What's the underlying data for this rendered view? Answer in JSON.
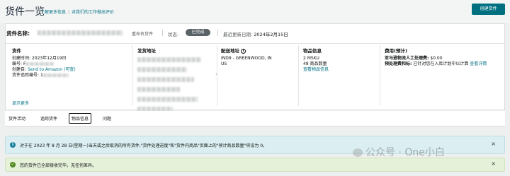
{
  "header": {
    "title": "货件一览",
    "links": [
      "了解更多信息",
      "对我们的工作做出评价"
    ],
    "create_button": "创建货件"
  },
  "shipment": {
    "name_label": "货件名称:",
    "rename": "重命名货件",
    "status_label": "状态:",
    "status_value": "已完成",
    "updated_label": "最近更新日期:",
    "updated_value": "2024年2月15日"
  },
  "columns": {
    "shipment": {
      "heading": "货件",
      "created_time_label": "创建时间:",
      "created_time": "2023年12月19日",
      "id_label": "编号:",
      "id_value": "F",
      "created_by_label": "创建自:",
      "created_by_link": "Send to Amazon",
      "created_by_extra": "(可查)",
      "tracking_label": "货件追踪编号:",
      "tracking_value": "1"
    },
    "ship_from": {
      "heading": "发货地址"
    },
    "ship_to": {
      "heading": "配送地址",
      "line1": "IND9 - GREENWOOD, IN",
      "line2": "US"
    },
    "items": {
      "heading": "物品信息",
      "msku": "2 MSKU",
      "units": "48 商品数量",
      "link": "查看物品信息"
    },
    "fees": {
      "heading": "费用(预计)",
      "labor_label": "亚马逊物流人工处理费:",
      "labor_value": "$0.00",
      "placement_label": "预处理费和标:",
      "placement_value": "已针对您在入库计划中以计算",
      "placement_link": "查看详情"
    }
  },
  "show_more": "显示更多",
  "tabs": [
    "货件活动",
    "追踪货件",
    "物品信息",
    "问题"
  ],
  "active_tab": 2,
  "alerts": [
    "对于在 2023 年 8 月 28 日(星期一)当天或之后取消的所有货件,\"货件处理进度\"和\"货件内商品\"页面上的\"预计商品数量\"将设为 0。",
    "您的货件已全部接收完毕。无任何差异。"
  ],
  "watermark": "公众号 · One小白",
  "colors": {
    "accent": "#007080",
    "link": "#007185",
    "info_bg": "#dbeff2",
    "success_bg": "#e6f1da"
  }
}
